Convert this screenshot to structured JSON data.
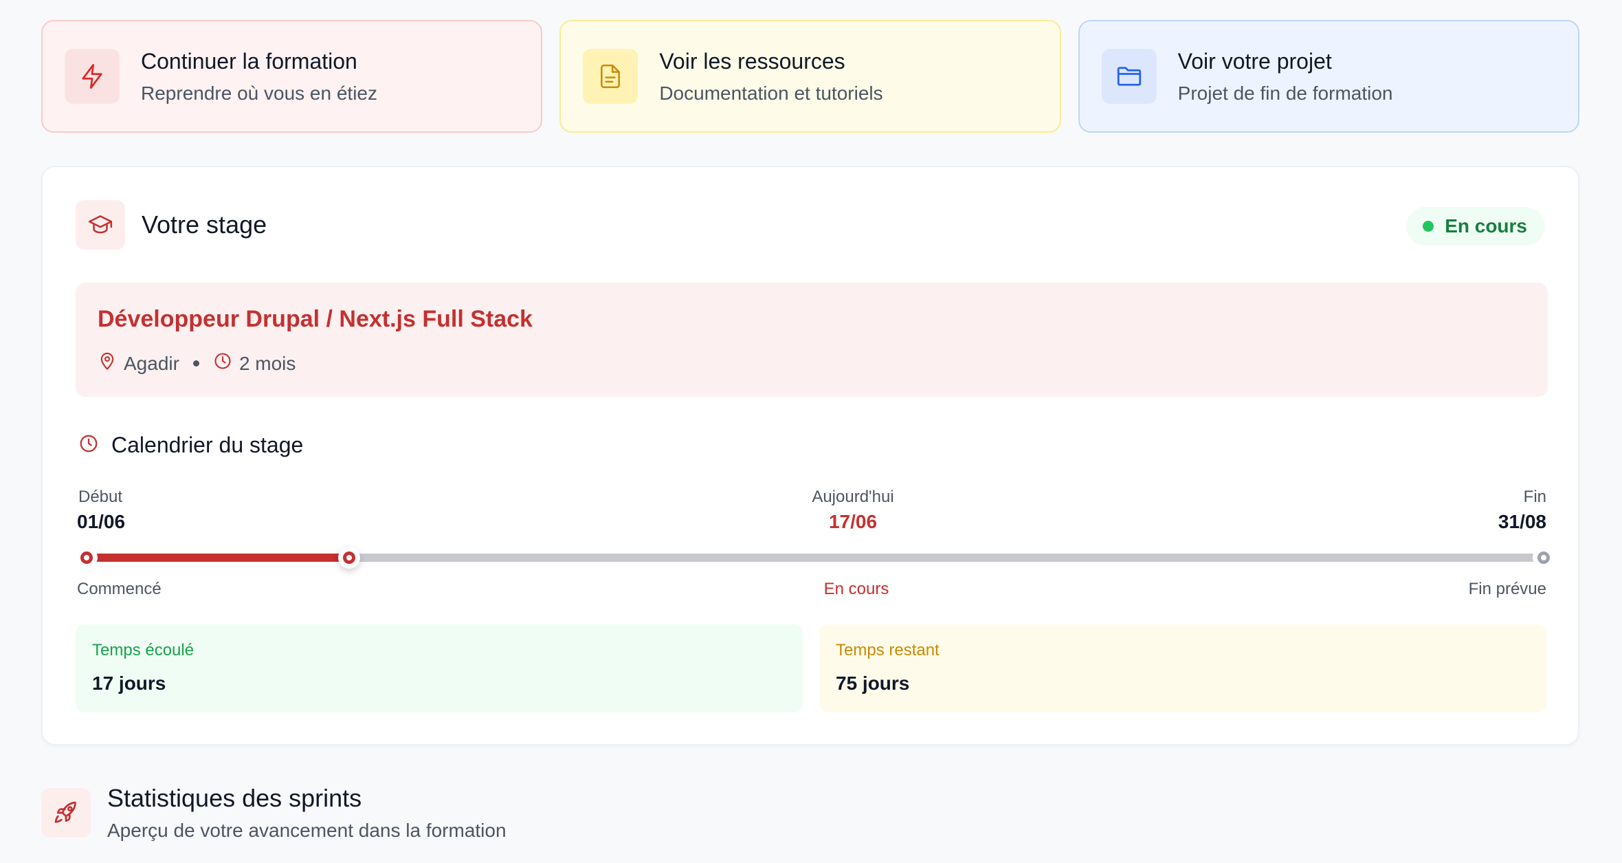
{
  "quick_actions": [
    {
      "title": "Continuer la formation",
      "subtitle": "Reprendre où vous en étiez",
      "icon": "lightning-icon",
      "color": "#dc2626"
    },
    {
      "title": "Voir les ressources",
      "subtitle": "Documentation et tutoriels",
      "icon": "document-icon",
      "color": "#ca8a04"
    },
    {
      "title": "Voir votre projet",
      "subtitle": "Projet de fin de formation",
      "icon": "folder-icon",
      "color": "#2563eb"
    }
  ],
  "stage": {
    "title": "Votre stage",
    "status": "En cours",
    "status_color": "#22c55e",
    "job_title": "Développeur Drupal / Next.js Full Stack",
    "location": "Agadir",
    "duration": "2 mois",
    "calendar": {
      "title": "Calendrier du stage",
      "start_label": "Début",
      "start_date": "01/06",
      "today_label": "Aujourd'hui",
      "today_date": "17/06",
      "end_label": "Fin",
      "end_date": "31/08",
      "start_status": "Commencé",
      "today_status": "En cours",
      "end_status": "Fin prévue",
      "progress_fraction": 0.18,
      "elapsed_label": "Temps écoulé",
      "elapsed_value": "17 jours",
      "remaining_label": "Temps restant",
      "remaining_value": "75 jours"
    }
  },
  "sprints": {
    "title": "Statistiques des sprints",
    "subtitle": "Aperçu de votre avancement dans la formation"
  },
  "colors": {
    "accent": "#c53030",
    "success": "#16a34a",
    "warning": "#ca8a04"
  }
}
